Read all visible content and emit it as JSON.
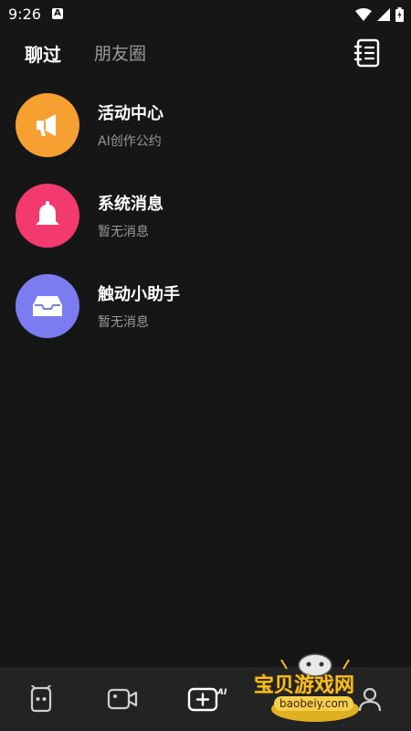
{
  "status_bar": {
    "time": "9:26",
    "notification_letter": "A"
  },
  "header": {
    "tabs": [
      {
        "label": "聊过"
      },
      {
        "label": "朋友圈"
      }
    ],
    "notebook_icon": "notebook-icon"
  },
  "conversations": [
    {
      "title": "活动中心",
      "subtitle": "AI创作公约",
      "icon": "megaphone-icon",
      "color": "#F7A032"
    },
    {
      "title": "系统消息",
      "subtitle": "暂无消息",
      "icon": "bell-icon",
      "color": "#F23A6E"
    },
    {
      "title": "触动小助手",
      "subtitle": "暂无消息",
      "icon": "inbox-icon",
      "color": "#7B7CF0"
    }
  ],
  "bottom_nav": {
    "items": [
      {
        "icon": "robot-face-icon"
      },
      {
        "icon": "video-camera-icon"
      },
      {
        "icon": "ai-create-icon",
        "label": "AI"
      },
      {
        "icon": "profile-icon"
      }
    ]
  },
  "watermark": {
    "text": "宝贝游戏网",
    "url": "baobeiy.com"
  }
}
